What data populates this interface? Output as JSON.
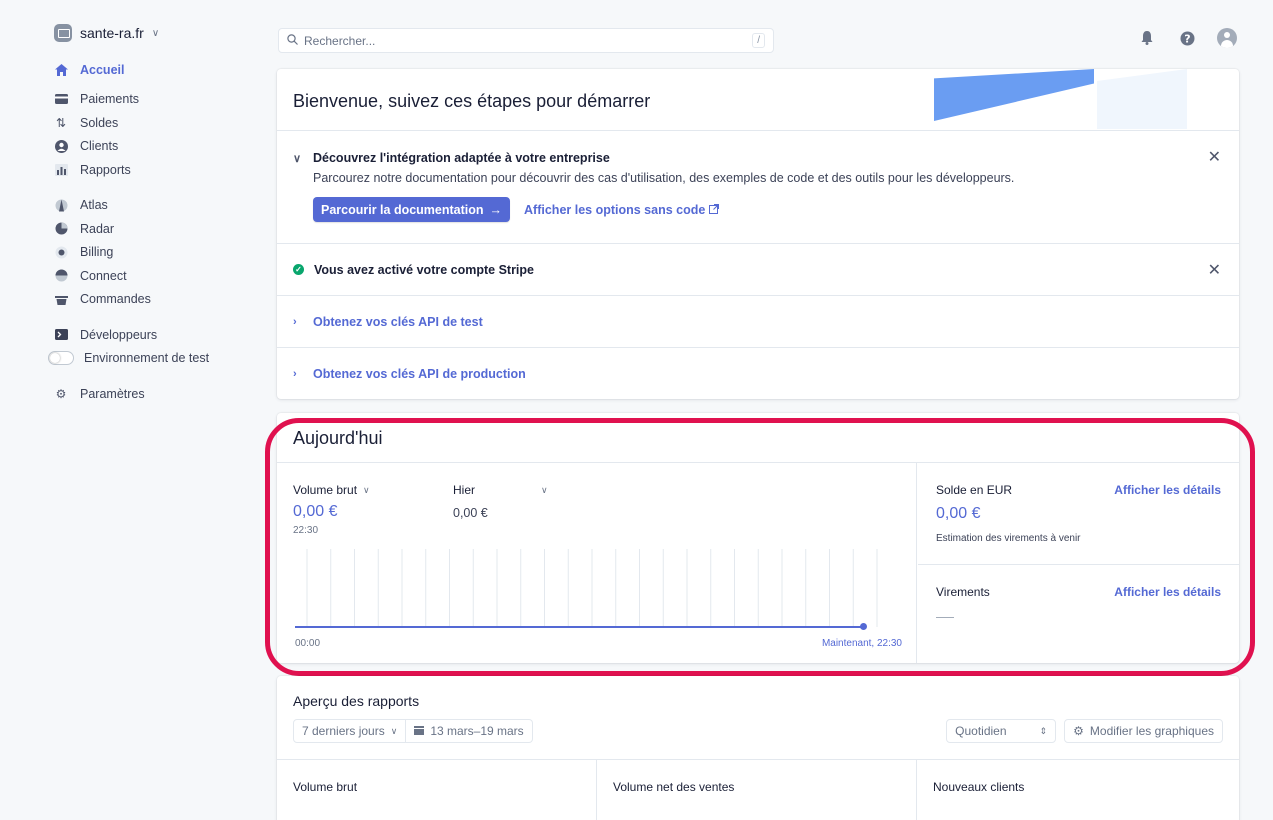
{
  "account": {
    "name": "sante-ra.fr"
  },
  "nav": {
    "home": "Accueil",
    "group1": [
      "Paiements",
      "Soldes",
      "Clients",
      "Rapports"
    ],
    "group2": [
      "Atlas",
      "Radar",
      "Billing",
      "Connect",
      "Commandes"
    ],
    "developers": "Développeurs",
    "test_env": "Environnement de test",
    "settings": "Paramètres"
  },
  "search": {
    "placeholder": "Rechercher...",
    "shortcut": "/"
  },
  "onboarding": {
    "title": "Bienvenue, suivez ces étapes pour démarrer",
    "integration": {
      "title": "Découvrez l'intégration adaptée à votre entreprise",
      "desc": "Parcourez notre documentation pour découvrir des cas d'utilisation, des exemples de code et des outils pour les développeurs.",
      "primary": "Parcourir la documentation",
      "secondary": "Afficher les options sans code"
    },
    "activated": "Vous avez activé votre compte Stripe",
    "test_keys": "Obtenez vos clés API de test",
    "prod_keys": "Obtenez vos clés API de production"
  },
  "today": {
    "title": "Aujourd'hui",
    "gross_label": "Volume brut",
    "gross_value": "0,00 €",
    "gross_time": "22:30",
    "compare_label": "Hier",
    "compare_value": "0,00 €",
    "chart_start": "00:00",
    "chart_end": "Maintenant, 22:30",
    "balance_label": "Solde en EUR",
    "balance_link": "Afficher les détails",
    "balance_value": "0,00 €",
    "balance_sub": "Estimation des virements à venir",
    "payouts_label": "Virements",
    "payouts_link": "Afficher les détails"
  },
  "reports": {
    "title": "Aperçu des rapports",
    "range": "7 derniers jours",
    "dates": "13 mars–19 mars",
    "interval": "Quotidien",
    "edit": "Modifier les graphiques",
    "cols": [
      "Volume brut",
      "Volume net des ventes",
      "Nouveaux clients"
    ]
  },
  "colors": {
    "accent": "#5469d4",
    "highlight": "#e0114f",
    "success": "#09a66d"
  }
}
